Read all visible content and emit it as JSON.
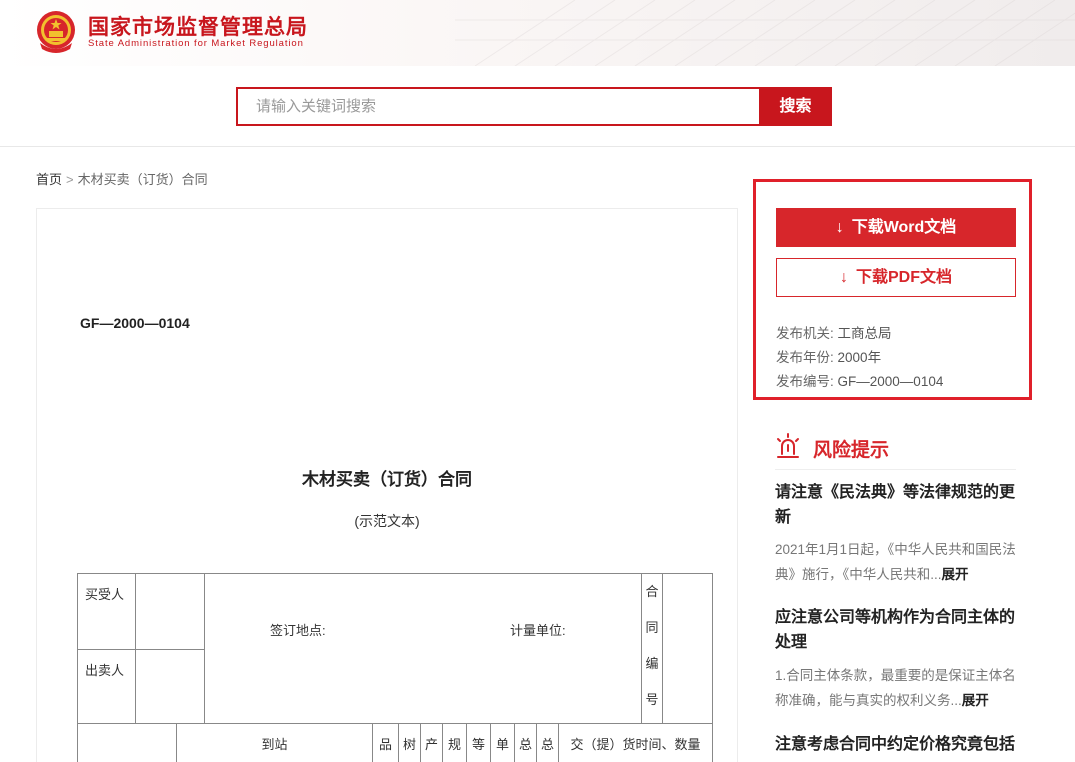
{
  "header": {
    "brand_cn": "国家市场监督管理总局",
    "brand_en": "State Administration for Market Regulation"
  },
  "search": {
    "placeholder": "请输入关键词搜索",
    "button_label": "搜索"
  },
  "breadcrumb": {
    "home": "首页",
    "separator": ">",
    "current": "木材买卖（订货）合同"
  },
  "document": {
    "code": "GF—2000—0104",
    "title": "木材买卖（订货）合同",
    "subtitle": "(示范文本)",
    "table": {
      "buyer_label": "买受人",
      "seller_label": "出卖人",
      "place_label": "签订地点:",
      "unit_label": "计量单位:",
      "contract_no_chars": [
        "合",
        "同",
        "编",
        "号"
      ],
      "row_headers": [
        "到站",
        "品",
        "树",
        "产",
        "规",
        "等",
        "单",
        "总",
        "总",
        "交（提）货时间、数量"
      ]
    }
  },
  "download": {
    "word_label": "下载Word文档",
    "pdf_label": "下载PDF文档",
    "meta": [
      {
        "key": "发布机关:",
        "value": "工商总局"
      },
      {
        "key": "发布年份:",
        "value": "2000年"
      },
      {
        "key": "发布编号:",
        "value": "GF—2000—0104"
      }
    ]
  },
  "risk": {
    "title": "风险提示",
    "articles": [
      {
        "title": "请注意《民法典》等法律规范的更新",
        "body": "2021年1月1日起，《中华人民共和国民法典》施行，《中华人民共和...",
        "expand": "展开"
      },
      {
        "title": "应注意公司等机构作为合同主体的处理",
        "body": "1.合同主体条款，最重要的是保证主体名称准确，能与真实的权利义务...",
        "expand": "展开"
      },
      {
        "title": "注意考虑合同中约定价格究竟包括"
      }
    ]
  },
  "colors": {
    "brand_red": "#c8161d",
    "button_red": "#d7262b",
    "highlight_border": "#e0202a"
  }
}
